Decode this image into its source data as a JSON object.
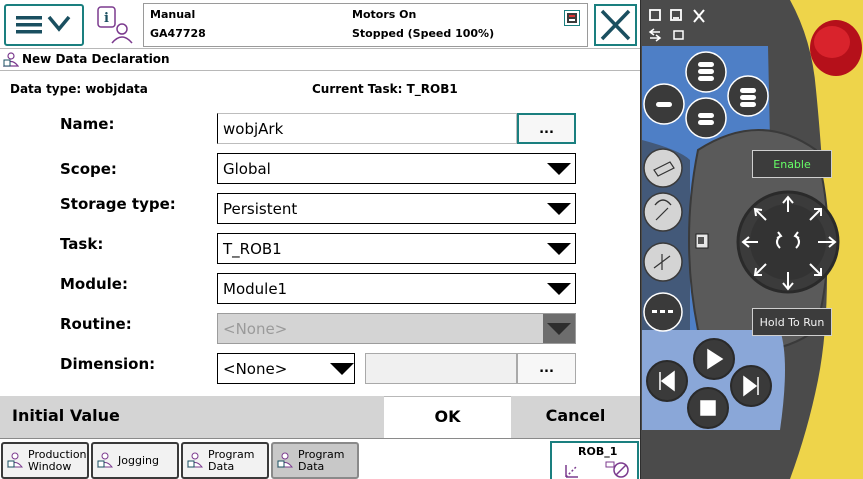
{
  "status": {
    "mode": "Manual",
    "controller": "GA47728",
    "motors": "Motors On",
    "state": "Stopped (Speed 100%)"
  },
  "header": {
    "title": "New Data Declaration",
    "data_type": "Data type: wobjdata",
    "current_task": "Current Task:  T_ROB1"
  },
  "form": {
    "name_label": "Name:",
    "name_value": "wobjArk",
    "browse_label": "...",
    "scope_label": "Scope:",
    "scope_value": "Global",
    "storage_label": "Storage type:",
    "storage_value": "Persistent",
    "task_label": "Task:",
    "task_value": "T_ROB1",
    "module_label": "Module:",
    "module_value": "Module1",
    "routine_label": "Routine:",
    "routine_value": "<None>",
    "dimension_label": "Dimension:",
    "dimension_value": "<None>",
    "dimension_browse_label": "..."
  },
  "actions": {
    "initial_value": "Initial Value",
    "ok": "OK",
    "cancel": "Cancel"
  },
  "taskbar": {
    "items": [
      {
        "line1": "Production",
        "line2": "Window"
      },
      {
        "line1": "Jogging",
        "line2": ""
      },
      {
        "line1": "Program",
        "line2": "Data"
      },
      {
        "line1": "Program",
        "line2": "Data"
      }
    ],
    "rob_label": "ROB_1"
  },
  "pendant": {
    "enable_label": "Enable",
    "hold_label": "Hold To Run"
  },
  "colors": {
    "accent": "#1a7f7f",
    "pendant_yellow": "#eed44a",
    "pendant_body": "#4b4b4b",
    "pendant_blue": "#4e7fc6",
    "estop_red": "#c8121c"
  }
}
